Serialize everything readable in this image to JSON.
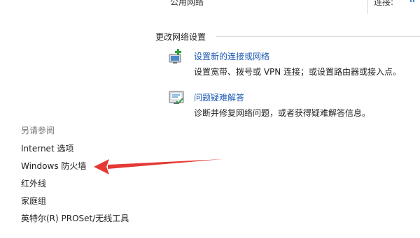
{
  "top": {
    "network_type": "公用网络",
    "connection_label": "连接:"
  },
  "section": {
    "title": "更改网络设置"
  },
  "tasks": [
    {
      "link": "设置新的连接或网络",
      "description": "设置宽带、拨号或 VPN 连接；或设置路由器或接入点。",
      "icon": "new-connection-icon"
    },
    {
      "link": "问题疑难解答",
      "description": "诊断并修复网络问题，或者获得疑难解答信息。",
      "icon": "troubleshoot-icon"
    }
  ],
  "see_also": {
    "title": "另请参阅",
    "items": [
      "Internet 选项",
      "Windows 防火墙",
      "红外线",
      "家庭组",
      "英特尔(R) PROSet/无线工具"
    ]
  },
  "annotation": {
    "icon": "red-arrow-icon",
    "color": "#e53935",
    "points_to": "Windows 防火墙"
  },
  "colors": {
    "link": "#1c5ab4",
    "text": "#1e1e1e",
    "muted": "#7a7a7a"
  }
}
